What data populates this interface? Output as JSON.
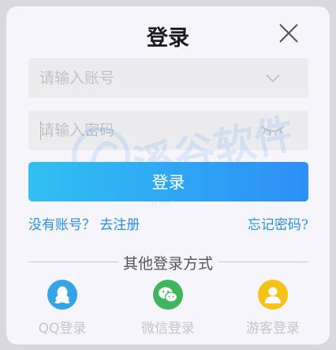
{
  "dialog": {
    "title": "登录"
  },
  "account_field": {
    "placeholder": "请输入账号"
  },
  "password_field": {
    "placeholder": "请输入密码"
  },
  "login_button_label": "登录",
  "links": {
    "register": "没有账号？ 去注册",
    "forgot": "忘记密码?"
  },
  "other_login": {
    "title": "其他登录方式",
    "options": [
      {
        "label": "QQ登录",
        "icon": "qq-icon",
        "color": "#36a3e5"
      },
      {
        "label": "微信登录",
        "icon": "wechat-icon",
        "color": "#3fb55e"
      },
      {
        "label": "游客登录",
        "icon": "guest-icon",
        "color": "#f5c218"
      }
    ]
  },
  "watermark": {
    "text": "溪谷软件",
    "domain": "vlgdk.com"
  },
  "colors": {
    "accent_start": "#31c0f2",
    "accent_end": "#2d8ff7",
    "link": "#2b8ee6"
  }
}
